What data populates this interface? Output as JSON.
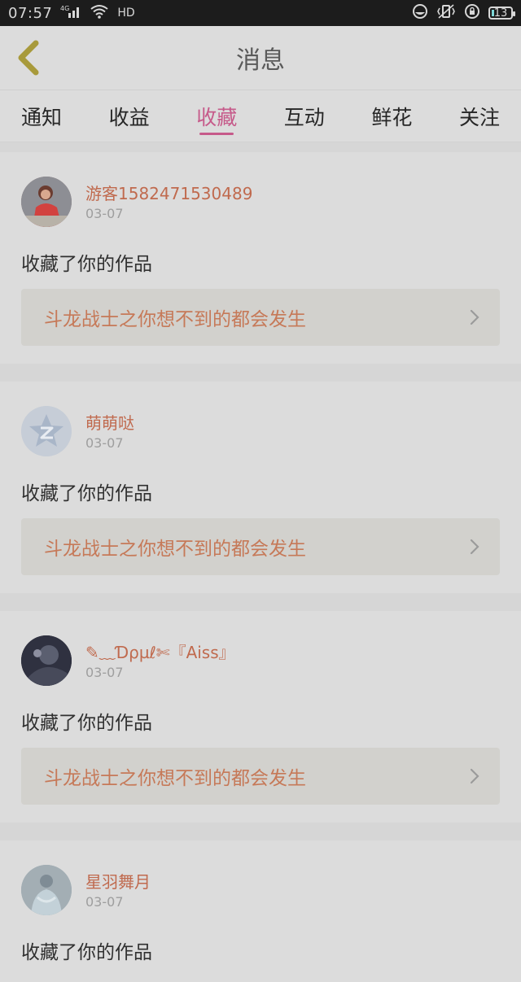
{
  "status_bar": {
    "time": "07:57",
    "network": "4G",
    "hd": "HD",
    "battery": "13"
  },
  "header": {
    "title": "消息"
  },
  "tabs": [
    {
      "label": "通知",
      "active": false
    },
    {
      "label": "收益",
      "active": false
    },
    {
      "label": "收藏",
      "active": true
    },
    {
      "label": "互动",
      "active": false
    },
    {
      "label": "鲜花",
      "active": false
    },
    {
      "label": "关注",
      "active": false
    }
  ],
  "messages": [
    {
      "username": "游客1582471530489",
      "date": "03-07",
      "action": "收藏了你的作品",
      "work_title": "斗龙战士之你想不到的都会发生"
    },
    {
      "username": "萌萌哒",
      "date": "03-07",
      "action": "收藏了你的作品",
      "work_title": "斗龙战士之你想不到的都会发生"
    },
    {
      "username": "✎﹏Ɗρµℓ✄『Aiss』",
      "date": "03-07",
      "action": "收藏了你的作品",
      "work_title": "斗龙战士之你想不到的都会发生"
    },
    {
      "username": "星羽舞月",
      "date": "03-07",
      "action": "收藏了你的作品",
      "work_title": ""
    }
  ],
  "colors": {
    "accent": "#c65a8a",
    "username": "#c06a4e",
    "work_title": "#c67958",
    "background": "#dcdcdc"
  }
}
